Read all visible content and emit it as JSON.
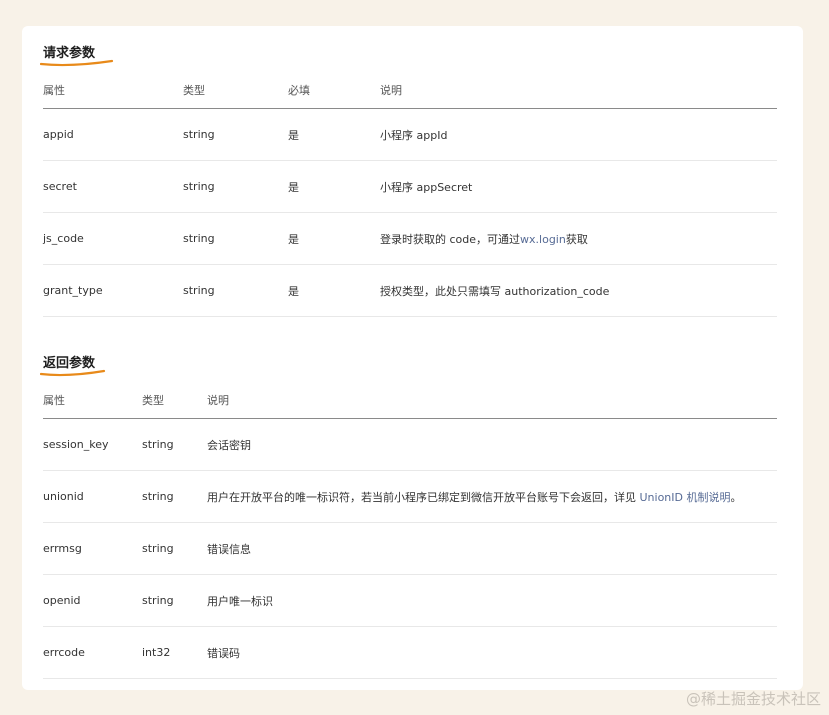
{
  "request_section": {
    "title": "请求参数",
    "headers": [
      "属性",
      "类型",
      "必填",
      "说明"
    ],
    "rows": [
      {
        "name": "appid",
        "type": "string",
        "required": "是",
        "desc": "小程序 appId"
      },
      {
        "name": "secret",
        "type": "string",
        "required": "是",
        "desc": "小程序 appSecret"
      },
      {
        "name": "js_code",
        "type": "string",
        "required": "是",
        "desc_pre": "登录时获取的 code，可通过",
        "desc_link": "wx.login",
        "desc_post": "获取"
      },
      {
        "name": "grant_type",
        "type": "string",
        "required": "是",
        "desc": "授权类型，此处只需填写 authorization_code"
      }
    ]
  },
  "response_section": {
    "title": "返回参数",
    "headers": [
      "属性",
      "类型",
      "说明"
    ],
    "rows": [
      {
        "name": "session_key",
        "type": "string",
        "desc": "会话密钥"
      },
      {
        "name": "unionid",
        "type": "string",
        "desc_pre": "用户在开放平台的唯一标识符，若当前小程序已绑定到微信开放平台账号下会返回，详见 ",
        "desc_link": "UnionID 机制说明",
        "desc_post": "。"
      },
      {
        "name": "errmsg",
        "type": "string",
        "desc": "错误信息"
      },
      {
        "name": "openid",
        "type": "string",
        "desc": "用户唯一标识"
      },
      {
        "name": "errcode",
        "type": "int32",
        "desc": "错误码"
      }
    ]
  },
  "watermark": "@稀土掘金技术社区",
  "colors": {
    "background": "#f8f2e8",
    "underline": "#e88a1a",
    "link": "#576b95"
  }
}
